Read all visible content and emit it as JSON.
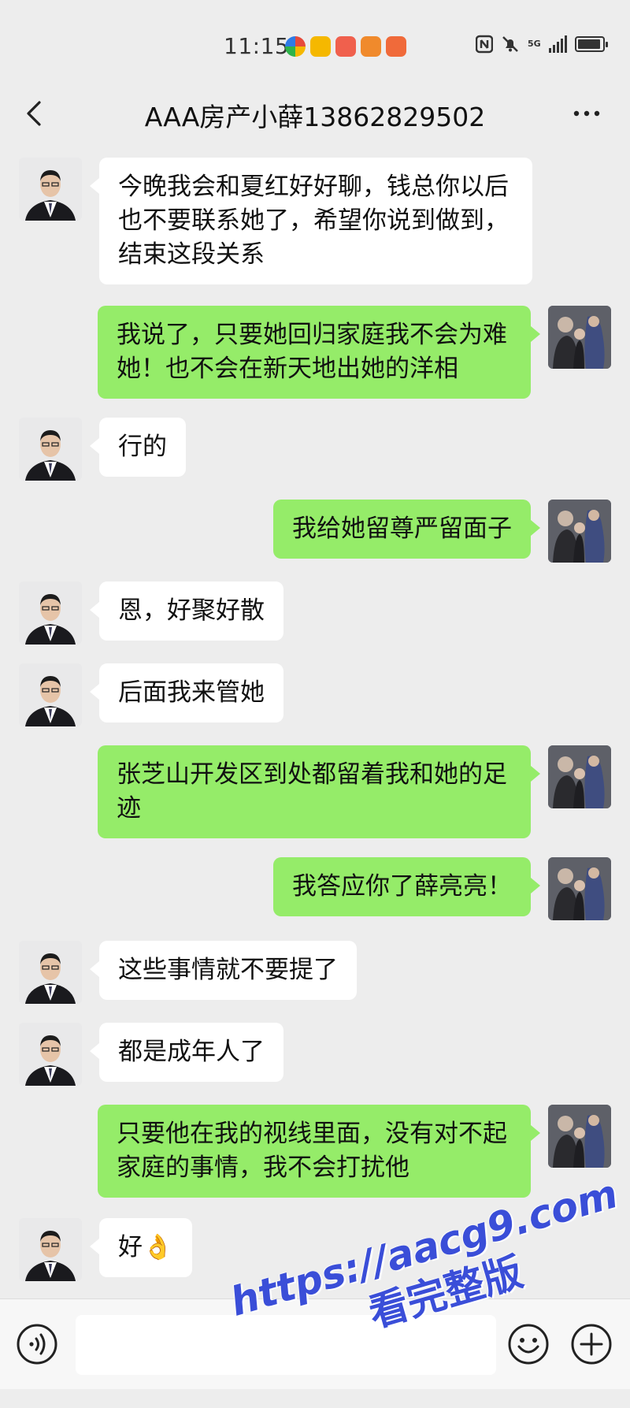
{
  "status_bar": {
    "time": "11:15",
    "network": "5G"
  },
  "header": {
    "title": "AAA房产小薛13862829502"
  },
  "messages": [
    {
      "side": "in",
      "text": "今晚我会和夏红好好聊，钱总你以后也不要联系她了，希望你说到做到，结束这段关系"
    },
    {
      "side": "out",
      "text": "我说了，只要她回归家庭我不会为难她！也不会在新天地出她的洋相"
    },
    {
      "side": "in",
      "text": "行的"
    },
    {
      "side": "out",
      "text": "我给她留尊严留面子"
    },
    {
      "side": "in",
      "text": "恩，好聚好散"
    },
    {
      "side": "in",
      "text": "后面我来管她"
    },
    {
      "side": "out",
      "text": "张芝山开发区到处都留着我和她的足迹"
    },
    {
      "side": "out",
      "text": "我答应你了薛亮亮！"
    },
    {
      "side": "in",
      "text": "这些事情就不要提了"
    },
    {
      "side": "in",
      "text": "都是成年人了"
    },
    {
      "side": "out",
      "text": "只要他在我的视线里面，没有对不起家庭的事情，我不会打扰他"
    },
    {
      "side": "in",
      "text": "好👌"
    }
  ],
  "watermark": {
    "url": "https://aacg9.com",
    "text": "看完整版"
  },
  "colors": {
    "background": "#ededed",
    "outgoing_bubble": "#95ec69",
    "incoming_bubble": "#ffffff",
    "watermark": "#3a4ed8"
  },
  "icons": {
    "back": "chevron-left-icon",
    "more": "more-dots-icon",
    "voice": "voice-icon",
    "emoji": "emoji-icon",
    "plus": "plus-icon"
  }
}
